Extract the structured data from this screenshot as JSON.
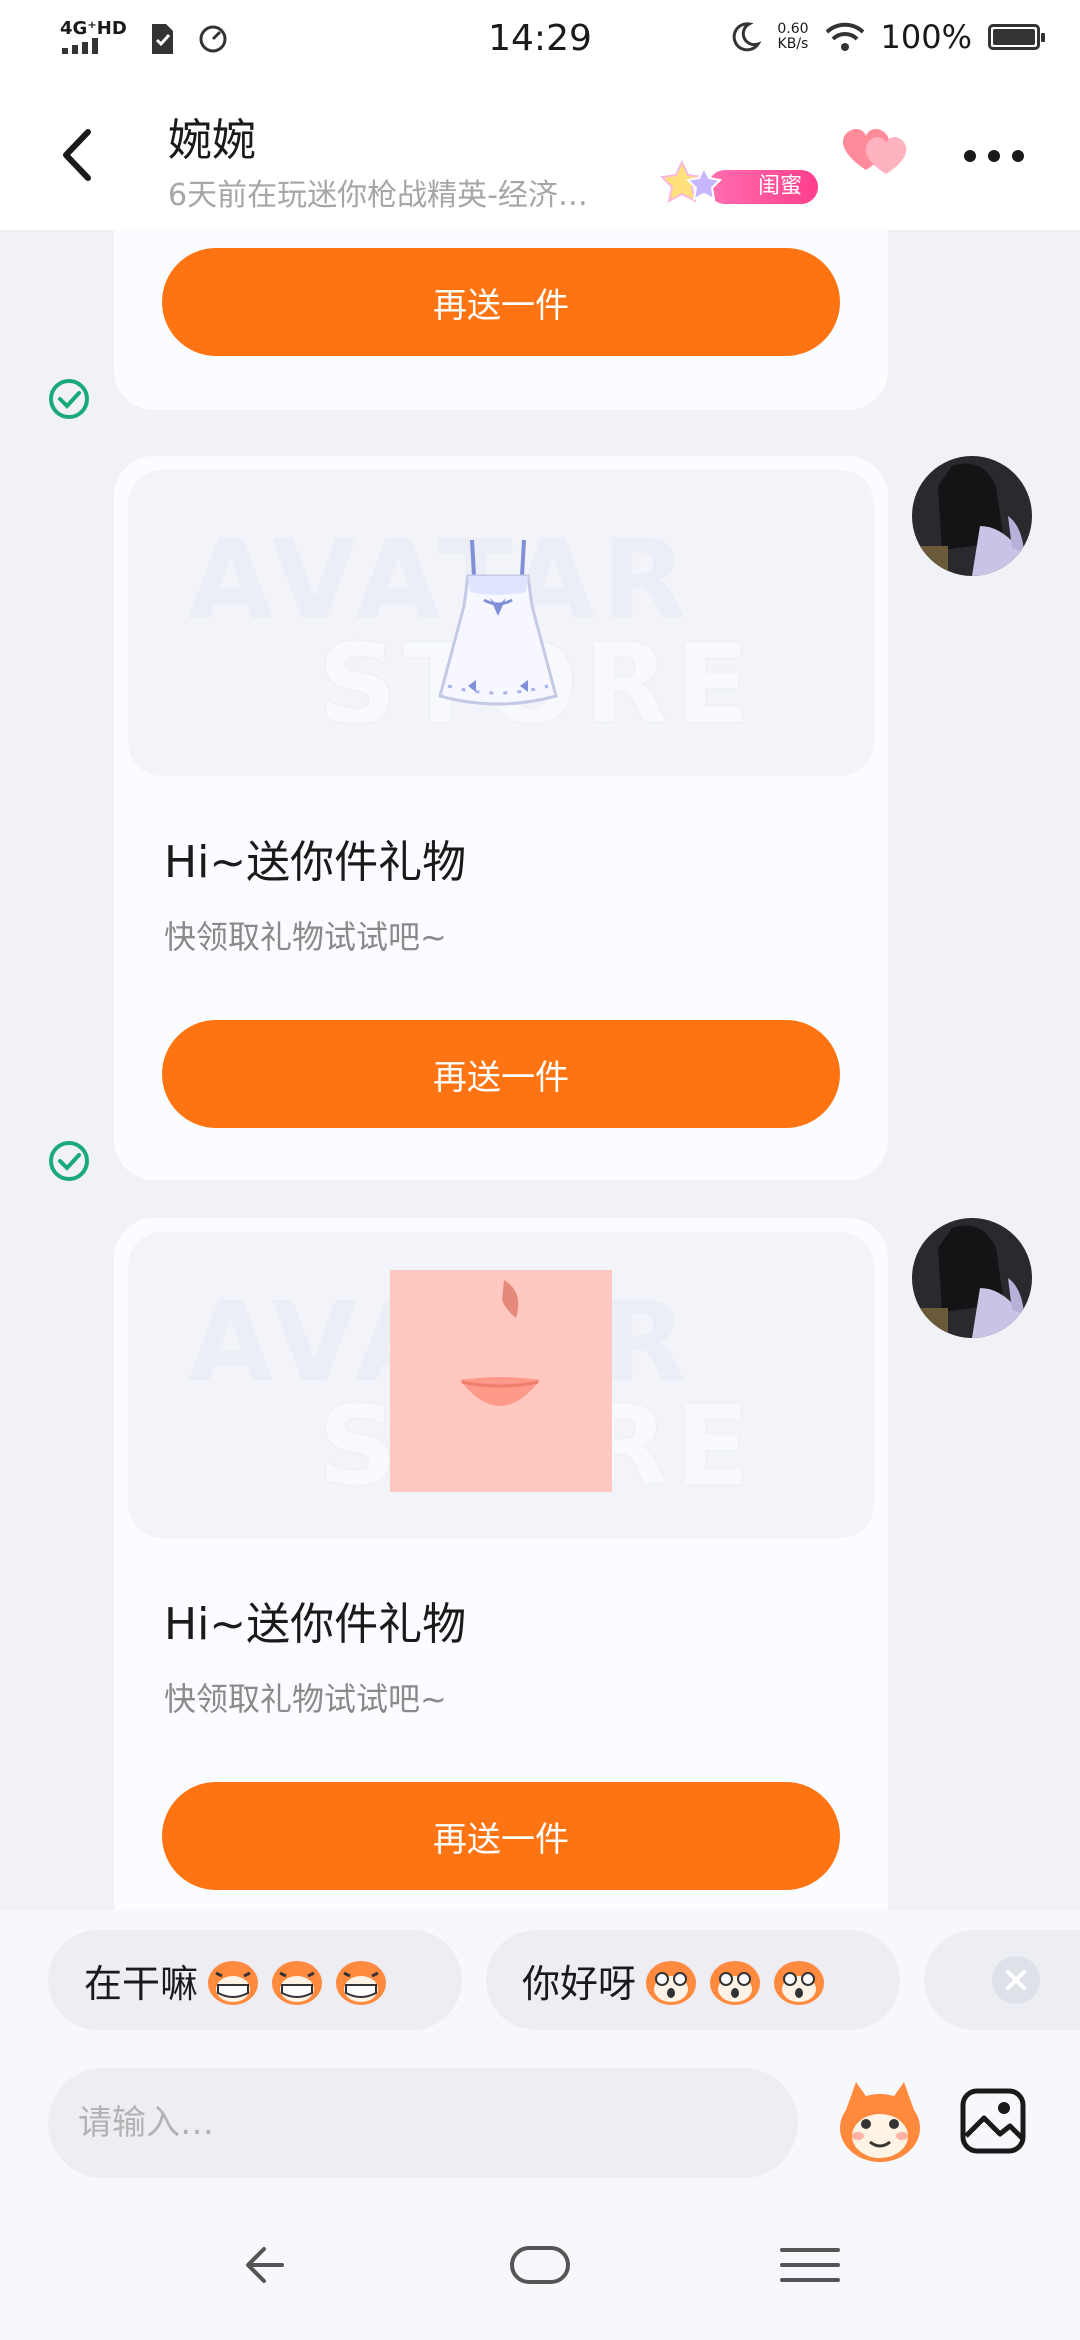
{
  "status_bar": {
    "network": "4G⁺HD",
    "time": "14:29",
    "speed_value": "0.60",
    "speed_unit": "KB/s",
    "battery": "100%"
  },
  "header": {
    "contact_name": "婉婉",
    "presence": "6天前在玩迷你枪战精英-经济…",
    "relation_badge": "闺蜜"
  },
  "messages": [
    {
      "has_preview": false,
      "button_label": "再送一件"
    },
    {
      "has_preview": true,
      "preview_item": "white-dress",
      "preview_watermark_1": "AVATAR",
      "preview_watermark_2": "STORE",
      "title": "Hi~送你件礼物",
      "subtitle": "快领取礼物试试吧~",
      "button_label": "再送一件"
    },
    {
      "has_preview": true,
      "preview_item": "face-mouth-skin",
      "preview_watermark_1": "AVATAR",
      "preview_watermark_2": "STORE",
      "title": "Hi~送你件礼物",
      "subtitle": "快领取礼物试试吧~",
      "button_label": "再送一件"
    }
  ],
  "quick_replies": [
    {
      "text": "在干嘛",
      "emoji": "grinning-squirrel"
    },
    {
      "text": "你好呀",
      "emoji": "surprised-squirrel"
    }
  ],
  "composer": {
    "placeholder": "请输入…"
  },
  "icons": {
    "back": "back-arrow-icon",
    "more": "more-dots-icon",
    "emoji": "squirrel-emoji-icon",
    "image": "image-icon",
    "sent": "check-circle-icon"
  },
  "colors": {
    "accent": "#ff7412",
    "check": "#1aaa7a",
    "badge": "#ff4f9a"
  }
}
